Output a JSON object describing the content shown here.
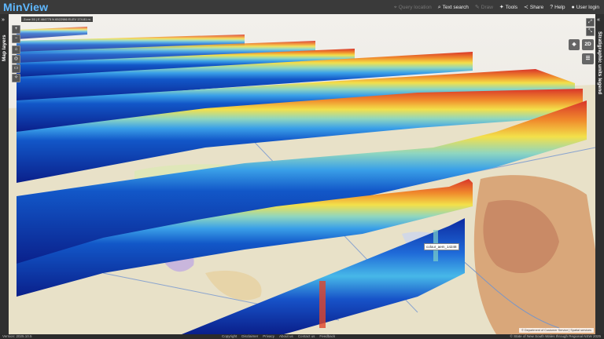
{
  "app": {
    "title": "MinView"
  },
  "nav": {
    "query_location": "Query location",
    "text_search": "Text search",
    "draw": "Draw",
    "tools": "Tools",
    "share": "Share",
    "help": "Help",
    "login": "User login"
  },
  "panels": {
    "left": "Map layers",
    "right": "Stratigraphic units legend"
  },
  "map": {
    "coords": "Zone 55 | E 464775 N 6522986 ELEV 174.81 m",
    "view_mode": "2D",
    "tooltip": "colour_aem_14248",
    "attribution": "© Department of Customer Service | Spatial services"
  },
  "footer": {
    "version": "Version: 2025.10.5",
    "links": [
      "Copyright",
      "Disclaimer",
      "Privacy",
      "About us",
      "Contact us",
      "Feedback"
    ],
    "copyright": "© State of New South Wales through Regional NSW 2025"
  }
}
